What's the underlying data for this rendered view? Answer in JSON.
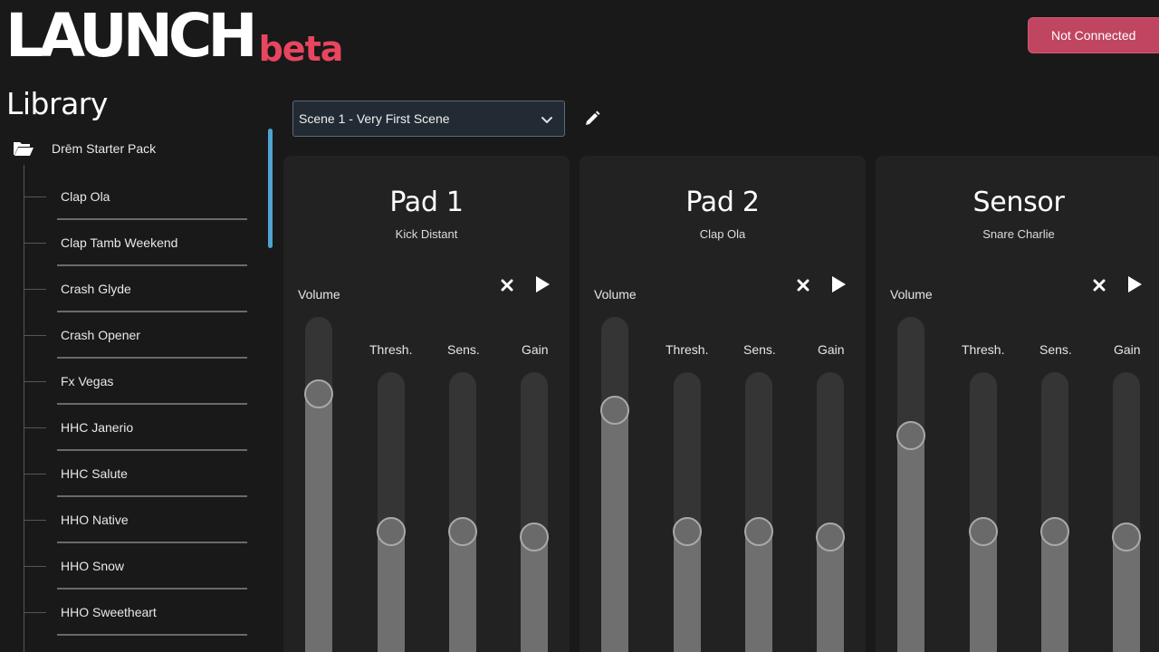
{
  "app": {
    "logo_main": "LAUNCH",
    "logo_badge": "beta"
  },
  "header": {
    "connection_status": "Not Connected",
    "colors": {
      "accent": "#c04560",
      "beta": "#e8455f"
    }
  },
  "library": {
    "title": "Library",
    "pack": {
      "name": "Drēm Starter Pack",
      "icon": "folder-open-icon"
    },
    "items": [
      "Clap Ola",
      "Clap Tamb Weekend",
      "Crash Glyde",
      "Crash Opener",
      "Fx Vegas",
      "HHC Janerio",
      "HHC Salute",
      "HHO Native",
      "HHO Snow",
      "HHO Sweetheart"
    ]
  },
  "scene": {
    "selected": "Scene 1 - Very First Scene",
    "edit_icon": "pencil-icon"
  },
  "labels": {
    "volume": "Volume",
    "thresh": "Thresh.",
    "sens": "Sens.",
    "gain": "Gain"
  },
  "panels": [
    {
      "title": "Pad 1",
      "sample": "Kick Distant",
      "levels": {
        "volume": 0.85,
        "thresh": 0.5,
        "sens": 0.5,
        "gain": 0.48
      }
    },
    {
      "title": "Pad 2",
      "sample": "Clap Ola",
      "levels": {
        "volume": 0.81,
        "thresh": 0.5,
        "sens": 0.5,
        "gain": 0.48
      }
    },
    {
      "title": "Sensor",
      "sample": "Snare Charlie",
      "levels": {
        "volume": 0.75,
        "thresh": 0.5,
        "sens": 0.5,
        "gain": 0.48
      }
    }
  ]
}
